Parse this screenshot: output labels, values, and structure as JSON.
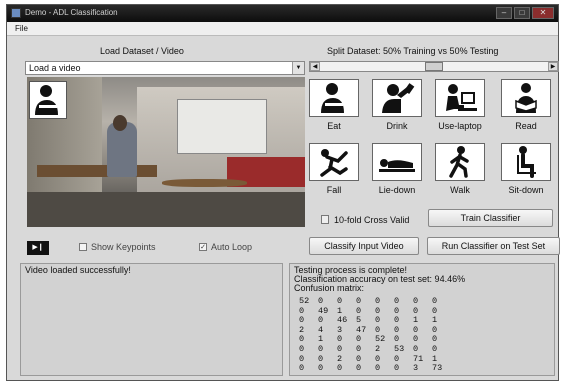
{
  "window": {
    "title": "Demo - ADL Classification",
    "buttons": [
      "–",
      "□",
      "✕"
    ]
  },
  "menu": {
    "file": "File"
  },
  "left": {
    "section_title": "Load Dataset / Video",
    "select_value": "Load a video",
    "show_keypoints": "Show Keypoints",
    "auto_loop": "Auto Loop",
    "play_label": "▶❙"
  },
  "right": {
    "split_title": "Split Dataset: 50% Training vs 50% Testing",
    "split_fraction": 0.5,
    "activities": [
      {
        "label": "Eat",
        "icon": "eat-icon"
      },
      {
        "label": "Drink",
        "icon": "drink-icon"
      },
      {
        "label": "Use-laptop",
        "icon": "use-laptop-icon"
      },
      {
        "label": "Read",
        "icon": "read-icon"
      },
      {
        "label": "Fall",
        "icon": "fall-icon"
      },
      {
        "label": "Lie-down",
        "icon": "lie-down-icon"
      },
      {
        "label": "Walk",
        "icon": "walk-icon"
      },
      {
        "label": "Sit-down",
        "icon": "sit-down-icon"
      }
    ],
    "cross_valid": "10-fold Cross Valid",
    "train_button": "Train Classifier",
    "classify_button": "Classify Input Video",
    "run_test_button": "Run Classifier on Test Set"
  },
  "status_left": "Video loaded successfully!",
  "status_right": {
    "line1": "Testing process is complete!",
    "line2": "Classification accuracy on test set: 94.46%",
    "line3": "Confusion matrix:",
    "matrix": [
      [
        "52",
        "0",
        "0",
        "0",
        "0",
        "0",
        "0",
        "0"
      ],
      [
        "0",
        "49",
        "1",
        "0",
        "0",
        "0",
        "0",
        "0"
      ],
      [
        "0",
        "0",
        "46",
        "5",
        "0",
        "0",
        "1",
        "1"
      ],
      [
        "2",
        "4",
        "3",
        "47",
        "0",
        "0",
        "0",
        "0"
      ],
      [
        "0",
        "1",
        "0",
        "0",
        "52",
        "0",
        "0",
        "0"
      ],
      [
        "0",
        "0",
        "0",
        "0",
        "2",
        "53",
        "0",
        "0"
      ],
      [
        "0",
        "0",
        "2",
        "0",
        "0",
        "0",
        "71",
        "1"
      ],
      [
        "0",
        "0",
        "0",
        "0",
        "0",
        "0",
        "3",
        "73"
      ]
    ]
  },
  "colors": {
    "window_bg": "#d9d9d9",
    "titlebar": "#111111",
    "sofa": "#9a2b2b"
  }
}
